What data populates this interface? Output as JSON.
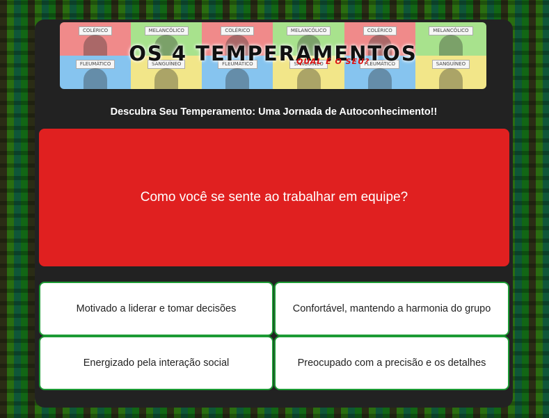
{
  "banner": {
    "title": "OS 4 TEMPERAMENTOS",
    "subtitle": "QUAL É O SEU?",
    "tiles": [
      {
        "label": "COLÉRICO",
        "color": "#f08a8a"
      },
      {
        "label": "MELANCÓLICO",
        "color": "#a8e28d"
      },
      {
        "label": "COLÉRICO",
        "color": "#f08a8a"
      },
      {
        "label": "MELANCÓLICO",
        "color": "#a8e28d"
      },
      {
        "label": "COLÉRICO",
        "color": "#f08a8a"
      },
      {
        "label": "MELANCÓLICO",
        "color": "#a8e28d"
      },
      {
        "label": "FLEUMÁTICO",
        "color": "#86c4ef"
      },
      {
        "label": "SANGUÍNEO",
        "color": "#f2e689"
      },
      {
        "label": "FLEUMÁTICO",
        "color": "#86c4ef"
      },
      {
        "label": "SANGUÍNEO",
        "color": "#f2e689"
      },
      {
        "label": "FLEUMÁTICO",
        "color": "#86c4ef"
      },
      {
        "label": "SANGUÍNEO",
        "color": "#f2e689"
      }
    ]
  },
  "subtitle": "Descubra Seu Temperamento: Uma Jornada de Autoconhecimento!!",
  "question": {
    "text": "Como você se sente ao trabalhar em equipe?",
    "background": "#e02020"
  },
  "answers": [
    "Motivado a liderar e tomar decisões",
    "Confortável, mantendo a harmonia do grupo",
    "Energizado pela interação social",
    "Preocupado com a precisão e os detalhes"
  ],
  "colors": {
    "panel": "#222222",
    "answer_border": "#1c9b34"
  }
}
